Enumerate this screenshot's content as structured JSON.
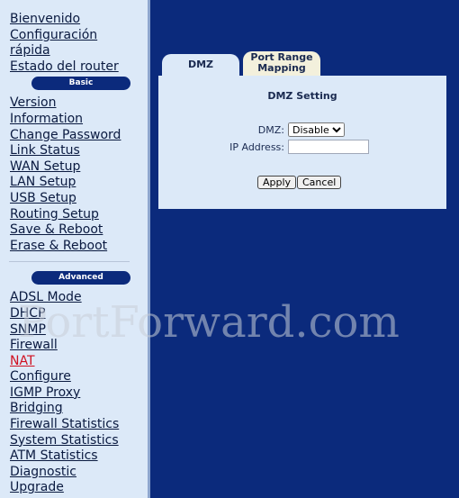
{
  "sidebar": {
    "top": [
      "Bienvenido",
      "Configuración rápida",
      "Estado del router"
    ],
    "basic_label": "Basic",
    "basic": [
      "Version Information",
      "Change Password",
      "Link Status",
      "WAN Setup",
      "LAN Setup",
      "USB Setup",
      "Routing Setup",
      "Save & Reboot",
      "Erase & Reboot"
    ],
    "advanced_label": "Advanced",
    "advanced": [
      "ADSL Mode",
      "DHCP",
      "SNMP",
      "Firewall",
      "NAT",
      "Configure",
      "IGMP Proxy",
      "Bridging",
      "Firewall Statistics",
      "System Statistics",
      "ATM Statistics",
      "Diagnostic",
      "Upgrade"
    ],
    "active": "NAT"
  },
  "tabs": [
    "DMZ",
    "Port Range Mapping"
  ],
  "form": {
    "title": "DMZ Setting",
    "dmz_label": "DMZ:",
    "dmz_value": "Disable",
    "ip_label": "IP Address:",
    "ip_value": "",
    "apply": "Apply",
    "cancel": "Cancel"
  },
  "watermark": "PortForward.com",
  "colors": {
    "sidebar_bg": "#dce9f8",
    "main_bg": "#0b2a7c",
    "active_link": "#d01020"
  }
}
